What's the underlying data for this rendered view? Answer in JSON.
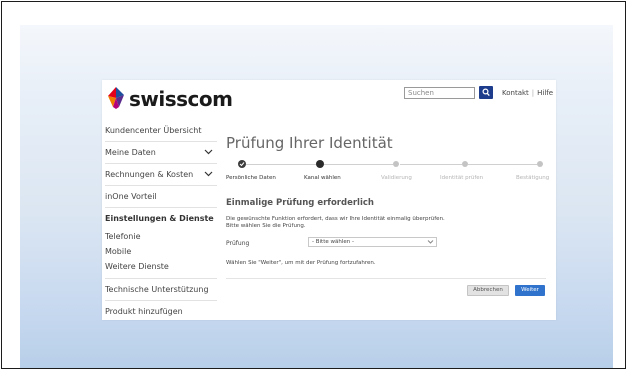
{
  "brand": {
    "name": "swisscom"
  },
  "header": {
    "search_placeholder": "Suchen",
    "links": [
      "Kontakt",
      "Hilfe"
    ],
    "separator": "|"
  },
  "sidebar": {
    "items": [
      {
        "label": "Kundencenter Übersicht"
      },
      {
        "label": "Meine Daten",
        "chevron": true
      },
      {
        "label": "Rechnungen & Kosten",
        "chevron": true
      },
      {
        "label": "inOne Vorteil"
      },
      {
        "label": "Einstellungen & Dienste",
        "active": true
      },
      {
        "label": "Telefonie"
      },
      {
        "label": "Mobile"
      },
      {
        "label": "Weitere Dienste"
      },
      {
        "label": "Technische Unterstützung"
      },
      {
        "label": "Produkt hinzufügen"
      }
    ]
  },
  "main": {
    "title": "Prüfung Ihrer Identität",
    "steps": [
      {
        "label": "Persönliche Daten",
        "state": "done"
      },
      {
        "label": "Kanal wählen",
        "state": "current"
      },
      {
        "label": "Validierung",
        "state": "future"
      },
      {
        "label": "Identität prüfen",
        "state": "future"
      },
      {
        "label": "Bestätigung",
        "state": "future"
      }
    ],
    "section_title": "Einmalige Prüfung erforderlich",
    "description_line1": "Die gewünschte Funktion erfordert, dass wir Ihre Identität einmalig überprüfen.",
    "description_line2": "Bitte wählen Sie die Prüfung.",
    "field_label": "Prüfung",
    "select_value": "- Bitte wählen -",
    "hint": "Wählen Sie \"Weiter\", um mit der Prüfung fortzufahren.",
    "cancel_label": "Abbrechen",
    "next_label": "Weiter"
  },
  "colors": {
    "accent_blue": "#2f73cc",
    "search_button": "#1d3c8c",
    "logo_red": "#e2001a",
    "logo_blue": "#1d4f9c"
  }
}
